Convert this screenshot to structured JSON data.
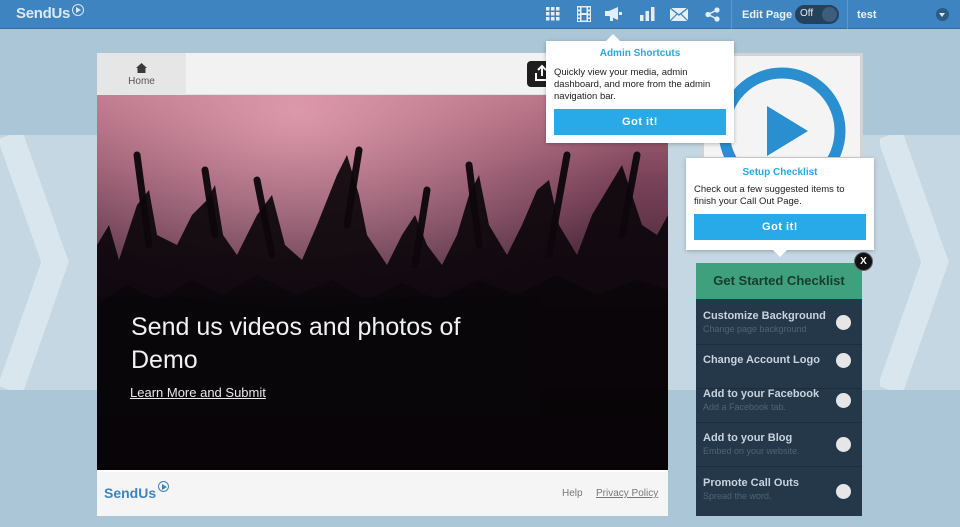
{
  "topbar": {
    "logo": "SendUs",
    "icons": [
      "grid-icon",
      "film-icon",
      "megaphone-icon",
      "bar-chart-icon",
      "mail-icon",
      "share-icon"
    ],
    "edit_page_label": "Edit Page",
    "toggle_label": "Off",
    "username": "test"
  },
  "nav": {
    "home_label": "Home"
  },
  "hero": {
    "headline": "Send us videos and photos of Demo",
    "learn_more": "Learn More and Submit"
  },
  "footer": {
    "logo": "SendUs",
    "help": "Help",
    "privacy": "Privacy Policy"
  },
  "tooltips": {
    "admin": {
      "title": "Admin Shortcuts",
      "body": "Quickly view your media, admin dashboard, and more from the admin navigation bar.",
      "button": "Got it!"
    },
    "setup": {
      "title": "Setup Checklist",
      "body": "Check out a few suggested items to finish your Call Out Page.",
      "button": "Got it!"
    }
  },
  "checklist": {
    "title": "Get Started Checklist",
    "close_label": "X",
    "items": [
      {
        "title": "Customize Background",
        "subtitle": "Change page background"
      },
      {
        "title": "Change Account Logo",
        "subtitle": ""
      },
      {
        "title": "Add to your Facebook",
        "subtitle": "Add a Facebook tab."
      },
      {
        "title": "Add to your Blog",
        "subtitle": "Embed on your website."
      },
      {
        "title": "Promote Call Outs",
        "subtitle": "Spread the word."
      }
    ]
  },
  "colors": {
    "topbar": "#3d84c0",
    "accent_button": "#29aae8",
    "checklist_header": "#3fa07d",
    "checklist_bg": "#24384a",
    "background": "#abc6d6"
  }
}
